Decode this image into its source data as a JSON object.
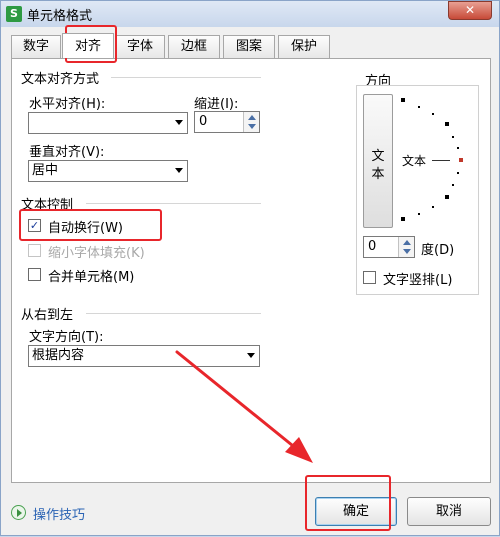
{
  "window": {
    "title": "单元格格式",
    "app_icon": "S",
    "close_label": "✕"
  },
  "tabs": [
    {
      "label": "数字",
      "active": false
    },
    {
      "label": "对齐",
      "active": true
    },
    {
      "label": "字体",
      "active": false
    },
    {
      "label": "边框",
      "active": false
    },
    {
      "label": "图案",
      "active": false
    },
    {
      "label": "保护",
      "active": false
    }
  ],
  "alignment": {
    "group_title": "文本对齐方式",
    "horizontal_label": "水平对齐(H):",
    "horizontal_value": "",
    "indent_label": "缩进(I):",
    "indent_value": "0",
    "vertical_label": "垂直对齐(V):",
    "vertical_value": "居中"
  },
  "text_control": {
    "group_title": "文本控制",
    "wrap_label": "自动换行(W)",
    "wrap_checked": true,
    "shrink_label": "缩小字体填充(K)",
    "shrink_checked": false,
    "merge_label": "合并单元格(M)",
    "merge_checked": false
  },
  "rtl": {
    "group_title": "从右到左",
    "direction_label": "文字方向(T):",
    "direction_value": "根据内容"
  },
  "orientation": {
    "group_title": "方向",
    "vertical_text_char1": "文",
    "vertical_text_char2": "本",
    "dial_label": "文本",
    "degrees_value": "0",
    "degrees_label": "度(D)",
    "vertical_stack_label": "文字竖排(L)",
    "vertical_stack_checked": false
  },
  "footer": {
    "tips_label": "操作技巧",
    "ok_label": "确定",
    "cancel_label": "取消"
  },
  "colors": {
    "highlight": "#e8262b",
    "dial_point": "#000000",
    "dial_active_point": "#c0392b"
  }
}
